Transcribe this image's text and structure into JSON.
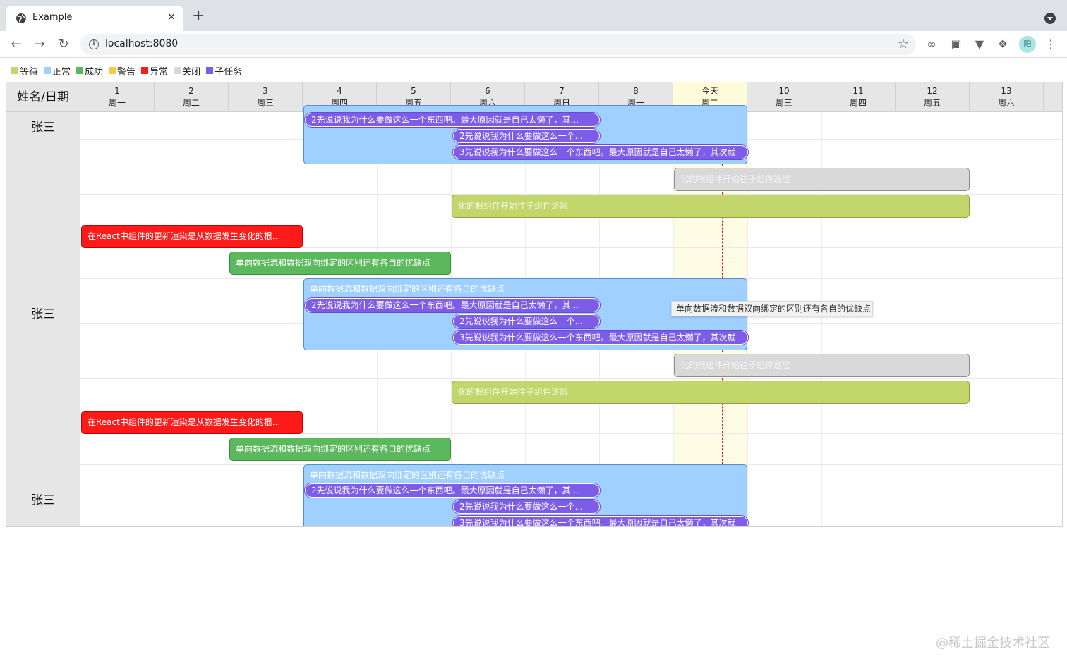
{
  "browser": {
    "tab_title": "Example",
    "tab_close": "✕",
    "new_tab": "+",
    "url": "localhost:8080",
    "avatar": "阳"
  },
  "legend": [
    {
      "label": "等待",
      "color": "#c3d66c"
    },
    {
      "label": "正常",
      "color": "#9fd0ff"
    },
    {
      "label": "成功",
      "color": "#5cb85c"
    },
    {
      "label": "警告",
      "color": "#f7c948"
    },
    {
      "label": "异常",
      "color": "#ff1a1a"
    },
    {
      "label": "关闭",
      "color": "#d9d9d9"
    },
    {
      "label": "子任务",
      "color": "#7d5ce8"
    }
  ],
  "gantt": {
    "corner_label": "姓名/日期",
    "days": [
      {
        "date": "1",
        "weekday": "周一"
      },
      {
        "date": "2",
        "weekday": "周二"
      },
      {
        "date": "3",
        "weekday": "周三"
      },
      {
        "date": "4",
        "weekday": "周四"
      },
      {
        "date": "5",
        "weekday": "周五"
      },
      {
        "date": "6",
        "weekday": "周六"
      },
      {
        "date": "7",
        "weekday": "周日"
      },
      {
        "date": "8",
        "weekday": "周一"
      },
      {
        "date": "今天",
        "weekday": "周二"
      },
      {
        "date": "10",
        "weekday": "周三"
      },
      {
        "date": "11",
        "weekday": "周四"
      },
      {
        "date": "12",
        "weekday": "周五"
      },
      {
        "date": "13",
        "weekday": "周六"
      }
    ],
    "rows": [
      {
        "name": "张三"
      },
      {
        "name": "张三"
      },
      {
        "name": "张三"
      }
    ],
    "task_labels": {
      "react": "在React中组件的更新渲染是从数据发生变化的根...",
      "oneway": "单向数据流和数据双向绑定的区别还有各自的优缺点",
      "sub1": "2先说说我为什么要做这么一个东西吧。最大原因就是自己太懒了，其...",
      "sub2": "2先说说我为什么要做这么一个...",
      "sub3": "3先说说我为什么要做这么一个东西吧。最大原因就是自己太懒了，其次就",
      "root": "化的根组件开始往子组件逐层"
    },
    "tooltip": "单向数据流和数据双向绑定的区别还有各自的优缺点"
  },
  "watermark": "@稀土掘金技术社区"
}
